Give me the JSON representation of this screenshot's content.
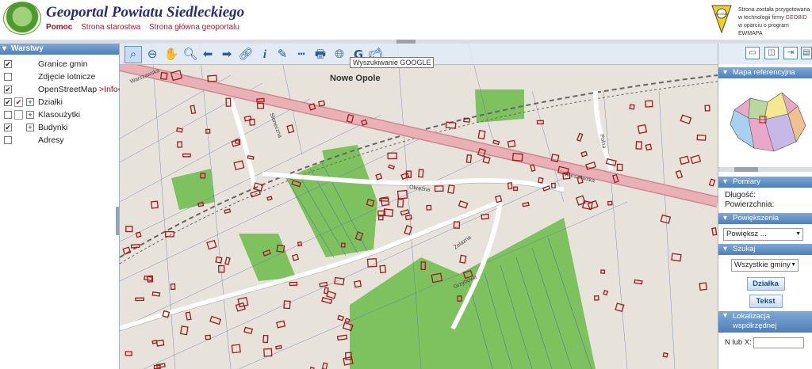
{
  "header": {
    "title": "Geoportal Powiatu Siedleckiego",
    "nav": [
      "Pomoc",
      "Strona starostwa",
      "Strona główna geoportalu"
    ],
    "credit_lines": [
      "Strona została przygotowana",
      "w technologii firmy ",
      "w oparciu o program EWMAPA"
    ],
    "credit_brand": "GEOBID",
    "logo_brand": "GEOBID"
  },
  "layers": {
    "title": "Warstwy",
    "items": [
      {
        "label": "Granice gmin",
        "checked": true,
        "expander": false,
        "icon": false,
        "info": ""
      },
      {
        "label": "Zdjęcie lotnicze",
        "checked": false,
        "expander": false,
        "icon": false,
        "info": ""
      },
      {
        "label": "OpenStreetMap ",
        "checked": true,
        "expander": false,
        "icon": false,
        "info": ">Info<"
      },
      {
        "label": "Działki",
        "checked": true,
        "expander": true,
        "icon": true,
        "info": ""
      },
      {
        "label": "Klasoużytki",
        "checked": false,
        "expander": true,
        "icon": true,
        "info": ""
      },
      {
        "label": "Budynki",
        "checked": true,
        "expander": true,
        "icon": false,
        "info": ""
      },
      {
        "label": "Adresy",
        "checked": false,
        "expander": false,
        "icon": false,
        "info": ""
      }
    ]
  },
  "map": {
    "tooltip": "Wyszukiwanie GOOGLE",
    "town_label": "Nowe Opole",
    "streets": {
      "warszawska_1": "Warszawska",
      "warszawska_2": "Warszawska",
      "okrezna": "Okrężna",
      "zelazna": "Żelazna",
      "grzybowa": "Grzybowa",
      "sloneczna": "Słoneczna",
      "polna": "Polna"
    },
    "colors": {
      "parcel": "#9e1b1b",
      "green": "#7dc25e",
      "road": "#e8a0a8",
      "cadastral": "#3355aa"
    }
  },
  "right": {
    "mapa_ref": "Mapa referencyjna",
    "pomiary": "Pomiary",
    "dlugosc": "Długość:",
    "powierzchnia": "Powierzchnia:",
    "powiekszenia": "Powiększenia",
    "powieksz_select": "Powiększ ...",
    "szukaj": "Szukaj",
    "gminy_select": "Wszystkie gminy",
    "dzialka_btn": "Działka",
    "tekst_btn": "Tekst",
    "lokalizacja": "Lokalizacja",
    "wspolrzednej": "współrzędnej",
    "n_label": "N lub X:"
  }
}
